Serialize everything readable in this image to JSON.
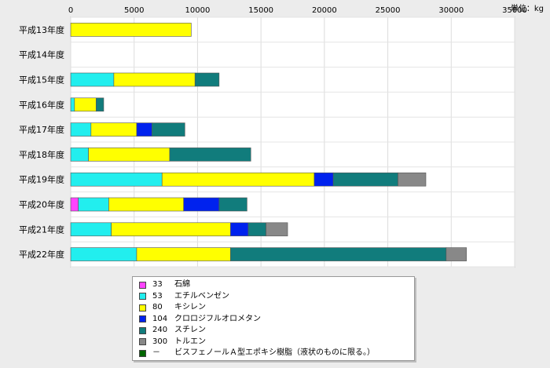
{
  "chart_data": {
    "type": "bar",
    "orientation": "horizontal",
    "stacked": true,
    "unit_label": "単位：kg",
    "categories": [
      "平成13年度",
      "平成14年度",
      "平成15年度",
      "平成16年度",
      "平成17年度",
      "平成18年度",
      "平成19年度",
      "平成20年度",
      "平成21年度",
      "平成22年度"
    ],
    "xlim": [
      0,
      35000
    ],
    "xticks": [
      0,
      5000,
      10000,
      15000,
      20000,
      25000,
      30000,
      35000
    ],
    "series": [
      {
        "code": "33",
        "name": "石綿",
        "color": "#ff44ff",
        "values": [
          0,
          0,
          0,
          0,
          0,
          0,
          0,
          600,
          0,
          0
        ]
      },
      {
        "code": "53",
        "name": "エチルベンゼン",
        "color": "#22eeee",
        "values": [
          0,
          0,
          3400,
          300,
          1600,
          1400,
          7200,
          2400,
          3200,
          5200
        ]
      },
      {
        "code": "80",
        "name": "キシレン",
        "color": "#ffff00",
        "values": [
          9500,
          0,
          6400,
          1700,
          3600,
          6400,
          12000,
          5900,
          9400,
          7400
        ]
      },
      {
        "code": "104",
        "name": "クロロジフルオロメタン",
        "color": "#0022ee",
        "values": [
          0,
          0,
          0,
          0,
          1200,
          0,
          1500,
          2800,
          1400,
          0
        ]
      },
      {
        "code": "240",
        "name": "スチレン",
        "color": "#117c7c",
        "values": [
          0,
          0,
          1900,
          600,
          2600,
          6400,
          5100,
          2200,
          1400,
          17000
        ]
      },
      {
        "code": "300",
        "name": "トルエン",
        "color": "#888888",
        "values": [
          0,
          0,
          0,
          0,
          0,
          0,
          2200,
          0,
          1700,
          1600
        ]
      },
      {
        "code": "－",
        "name": "ビスフェノールＡ型エポキシ樹脂（液状のものに限る。）",
        "color": "#006600",
        "values": [
          0,
          0,
          0,
          0,
          0,
          0,
          0,
          0,
          0,
          0
        ]
      }
    ],
    "grid": true,
    "legend_position": "bottom"
  }
}
